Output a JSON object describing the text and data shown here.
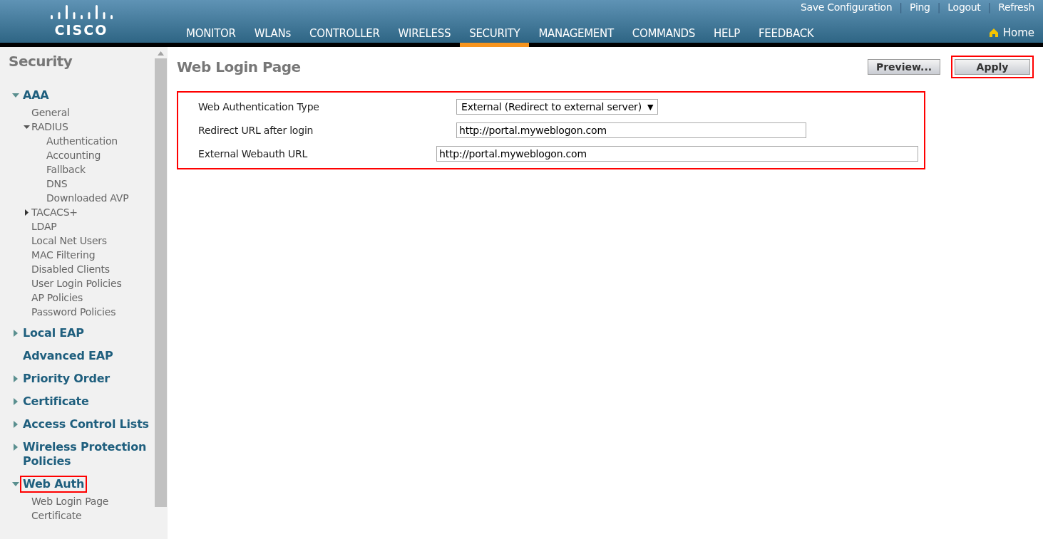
{
  "header": {
    "logo_text": "CISCO",
    "top_links": [
      "Save Configuration",
      "Ping",
      "Logout",
      "Refresh"
    ],
    "separator": "|",
    "nav": [
      {
        "label": "MONITOR",
        "selected": false
      },
      {
        "label": "WLANs",
        "selected": false
      },
      {
        "label": "CONTROLLER",
        "selected": false
      },
      {
        "label": "WIRELESS",
        "selected": false
      },
      {
        "label": "SECURITY",
        "selected": true
      },
      {
        "label": "MANAGEMENT",
        "selected": false
      },
      {
        "label": "COMMANDS",
        "selected": false
      },
      {
        "label": "HELP",
        "selected": false
      },
      {
        "label": "FEEDBACK",
        "selected": false
      }
    ],
    "home": {
      "label": "Home"
    }
  },
  "sidebar": {
    "title": "Security",
    "items": [
      {
        "label": "AAA",
        "expanded": true,
        "highlighted": false,
        "children": [
          {
            "label": "General"
          },
          {
            "label": "RADIUS",
            "expanded": true,
            "children": [
              {
                "label": "Authentication"
              },
              {
                "label": "Accounting"
              },
              {
                "label": "Fallback"
              },
              {
                "label": "DNS"
              },
              {
                "label": "Downloaded AVP"
              }
            ]
          },
          {
            "label": "TACACS+",
            "expanded": false
          },
          {
            "label": "LDAP"
          },
          {
            "label": "Local Net Users"
          },
          {
            "label": "MAC Filtering"
          },
          {
            "label": "Disabled Clients"
          },
          {
            "label": "User Login Policies"
          },
          {
            "label": "AP Policies"
          },
          {
            "label": "Password Policies"
          }
        ]
      },
      {
        "label": "Local EAP",
        "expanded": false,
        "highlighted": false
      },
      {
        "label": "Advanced EAP",
        "highlighted": false
      },
      {
        "label": "Priority Order",
        "expanded": false,
        "highlighted": false
      },
      {
        "label": "Certificate",
        "expanded": false,
        "highlighted": false
      },
      {
        "label": "Access Control Lists",
        "expanded": false,
        "highlighted": false
      },
      {
        "label": "Wireless Protection Policies",
        "expanded": false,
        "highlighted": false
      },
      {
        "label": "Web Auth",
        "expanded": true,
        "highlighted": true,
        "children": [
          {
            "label": "Web Login Page"
          },
          {
            "label": "Certificate"
          }
        ]
      }
    ]
  },
  "content": {
    "title": "Web Login Page",
    "buttons": [
      {
        "label": "Preview...",
        "highlighted": false
      },
      {
        "label": "Apply",
        "highlighted": true
      }
    ],
    "form": {
      "highlighted": true,
      "fields": [
        {
          "kind": "select",
          "label": "Web Authentication Type",
          "value": "External (Redirect to external server)",
          "arrow": "▼"
        },
        {
          "kind": "text",
          "label": "Redirect URL after login",
          "value": "http://portal.myweblogon.com"
        },
        {
          "kind": "wide-text",
          "label": "External Webauth URL",
          "value": "http://portal.myweblogon.com"
        }
      ]
    }
  }
}
